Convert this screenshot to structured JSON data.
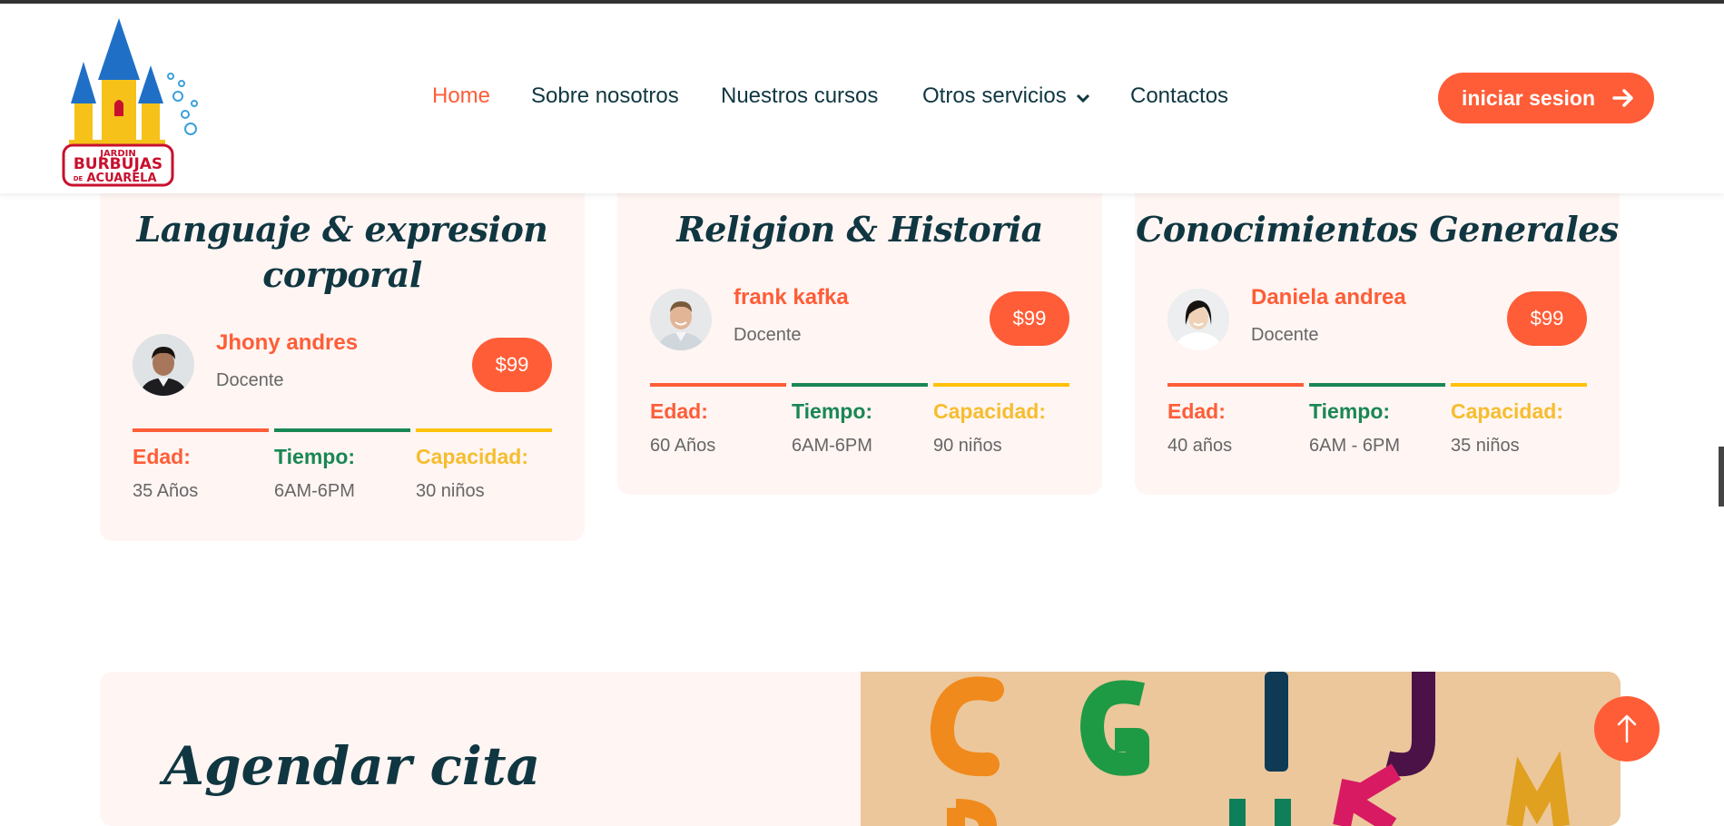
{
  "header": {
    "logo": {
      "text_lines": [
        "JARDIN",
        "BURBUJAS",
        "DE",
        "ACUARELA"
      ]
    },
    "nav": [
      {
        "label": "Home",
        "active": true
      },
      {
        "label": "Sobre nosotros"
      },
      {
        "label": "Nuestros cursos"
      },
      {
        "label": "Otros servicios",
        "has_dropdown": true
      },
      {
        "label": "Contactos"
      }
    ],
    "login_label": "iniciar sesion"
  },
  "courses": [
    {
      "title_line1": "Languaje & expresion",
      "title_line2": "corporal",
      "teacher": "Jhony andres",
      "role": "Docente",
      "price": "$99",
      "stats": [
        {
          "label": "Edad:",
          "value": "35 Años"
        },
        {
          "label": "Tiempo:",
          "value": "6AM-6PM"
        },
        {
          "label": "Capacidad:",
          "value": "30 niños"
        }
      ]
    },
    {
      "title_line1": "Religion & Historia",
      "teacher": "frank kafka",
      "role": "Docente",
      "price": "$99",
      "stats": [
        {
          "label": "Edad:",
          "value": "60 Años"
        },
        {
          "label": "Tiempo:",
          "value": "6AM-6PM"
        },
        {
          "label": "Capacidad:",
          "value": "90 niños"
        }
      ]
    },
    {
      "title_line1": "Conocimientos Generales",
      "teacher": "Daniela andrea",
      "role": "Docente",
      "price": "$99",
      "stats": [
        {
          "label": "Edad:",
          "value": "40 años"
        },
        {
          "label": "Tiempo:",
          "value": "6AM - 6PM"
        },
        {
          "label": "Capacidad:",
          "value": "35 niños"
        }
      ]
    }
  ],
  "appointment": {
    "title": "Agendar cita"
  },
  "colors": {
    "primary": "#fe5d37",
    "green": "#198754",
    "yellow": "#ffc107",
    "dark": "#103741",
    "card_bg": "#fff5f3"
  },
  "icons": [
    "arrow-right-icon",
    "chevron-down-icon",
    "arrow-up-icon"
  ]
}
